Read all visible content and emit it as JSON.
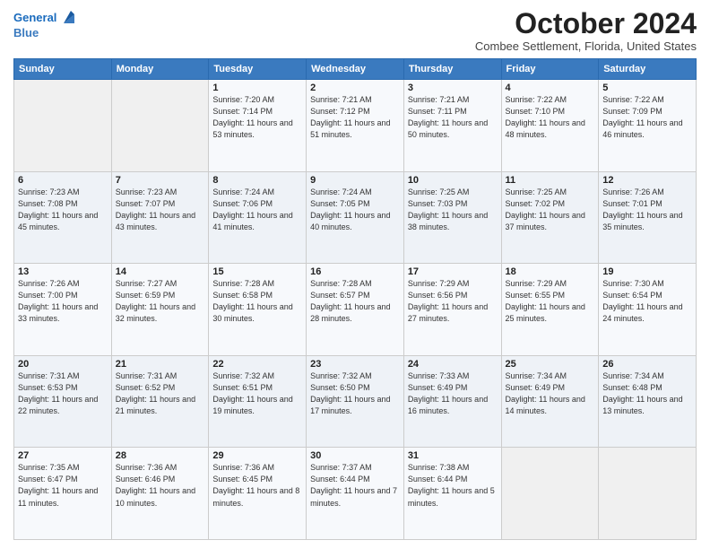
{
  "logo": {
    "line1": "General",
    "line2": "Blue"
  },
  "title": "October 2024",
  "location": "Combee Settlement, Florida, United States",
  "days_of_week": [
    "Sunday",
    "Monday",
    "Tuesday",
    "Wednesday",
    "Thursday",
    "Friday",
    "Saturday"
  ],
  "weeks": [
    [
      {
        "day": "",
        "info": ""
      },
      {
        "day": "",
        "info": ""
      },
      {
        "day": "1",
        "info": "Sunrise: 7:20 AM\nSunset: 7:14 PM\nDaylight: 11 hours and 53 minutes."
      },
      {
        "day": "2",
        "info": "Sunrise: 7:21 AM\nSunset: 7:12 PM\nDaylight: 11 hours and 51 minutes."
      },
      {
        "day": "3",
        "info": "Sunrise: 7:21 AM\nSunset: 7:11 PM\nDaylight: 11 hours and 50 minutes."
      },
      {
        "day": "4",
        "info": "Sunrise: 7:22 AM\nSunset: 7:10 PM\nDaylight: 11 hours and 48 minutes."
      },
      {
        "day": "5",
        "info": "Sunrise: 7:22 AM\nSunset: 7:09 PM\nDaylight: 11 hours and 46 minutes."
      }
    ],
    [
      {
        "day": "6",
        "info": "Sunrise: 7:23 AM\nSunset: 7:08 PM\nDaylight: 11 hours and 45 minutes."
      },
      {
        "day": "7",
        "info": "Sunrise: 7:23 AM\nSunset: 7:07 PM\nDaylight: 11 hours and 43 minutes."
      },
      {
        "day": "8",
        "info": "Sunrise: 7:24 AM\nSunset: 7:06 PM\nDaylight: 11 hours and 41 minutes."
      },
      {
        "day": "9",
        "info": "Sunrise: 7:24 AM\nSunset: 7:05 PM\nDaylight: 11 hours and 40 minutes."
      },
      {
        "day": "10",
        "info": "Sunrise: 7:25 AM\nSunset: 7:03 PM\nDaylight: 11 hours and 38 minutes."
      },
      {
        "day": "11",
        "info": "Sunrise: 7:25 AM\nSunset: 7:02 PM\nDaylight: 11 hours and 37 minutes."
      },
      {
        "day": "12",
        "info": "Sunrise: 7:26 AM\nSunset: 7:01 PM\nDaylight: 11 hours and 35 minutes."
      }
    ],
    [
      {
        "day": "13",
        "info": "Sunrise: 7:26 AM\nSunset: 7:00 PM\nDaylight: 11 hours and 33 minutes."
      },
      {
        "day": "14",
        "info": "Sunrise: 7:27 AM\nSunset: 6:59 PM\nDaylight: 11 hours and 32 minutes."
      },
      {
        "day": "15",
        "info": "Sunrise: 7:28 AM\nSunset: 6:58 PM\nDaylight: 11 hours and 30 minutes."
      },
      {
        "day": "16",
        "info": "Sunrise: 7:28 AM\nSunset: 6:57 PM\nDaylight: 11 hours and 28 minutes."
      },
      {
        "day": "17",
        "info": "Sunrise: 7:29 AM\nSunset: 6:56 PM\nDaylight: 11 hours and 27 minutes."
      },
      {
        "day": "18",
        "info": "Sunrise: 7:29 AM\nSunset: 6:55 PM\nDaylight: 11 hours and 25 minutes."
      },
      {
        "day": "19",
        "info": "Sunrise: 7:30 AM\nSunset: 6:54 PM\nDaylight: 11 hours and 24 minutes."
      }
    ],
    [
      {
        "day": "20",
        "info": "Sunrise: 7:31 AM\nSunset: 6:53 PM\nDaylight: 11 hours and 22 minutes."
      },
      {
        "day": "21",
        "info": "Sunrise: 7:31 AM\nSunset: 6:52 PM\nDaylight: 11 hours and 21 minutes."
      },
      {
        "day": "22",
        "info": "Sunrise: 7:32 AM\nSunset: 6:51 PM\nDaylight: 11 hours and 19 minutes."
      },
      {
        "day": "23",
        "info": "Sunrise: 7:32 AM\nSunset: 6:50 PM\nDaylight: 11 hours and 17 minutes."
      },
      {
        "day": "24",
        "info": "Sunrise: 7:33 AM\nSunset: 6:49 PM\nDaylight: 11 hours and 16 minutes."
      },
      {
        "day": "25",
        "info": "Sunrise: 7:34 AM\nSunset: 6:49 PM\nDaylight: 11 hours and 14 minutes."
      },
      {
        "day": "26",
        "info": "Sunrise: 7:34 AM\nSunset: 6:48 PM\nDaylight: 11 hours and 13 minutes."
      }
    ],
    [
      {
        "day": "27",
        "info": "Sunrise: 7:35 AM\nSunset: 6:47 PM\nDaylight: 11 hours and 11 minutes."
      },
      {
        "day": "28",
        "info": "Sunrise: 7:36 AM\nSunset: 6:46 PM\nDaylight: 11 hours and 10 minutes."
      },
      {
        "day": "29",
        "info": "Sunrise: 7:36 AM\nSunset: 6:45 PM\nDaylight: 11 hours and 8 minutes."
      },
      {
        "day": "30",
        "info": "Sunrise: 7:37 AM\nSunset: 6:44 PM\nDaylight: 11 hours and 7 minutes."
      },
      {
        "day": "31",
        "info": "Sunrise: 7:38 AM\nSunset: 6:44 PM\nDaylight: 11 hours and 5 minutes."
      },
      {
        "day": "",
        "info": ""
      },
      {
        "day": "",
        "info": ""
      }
    ]
  ]
}
